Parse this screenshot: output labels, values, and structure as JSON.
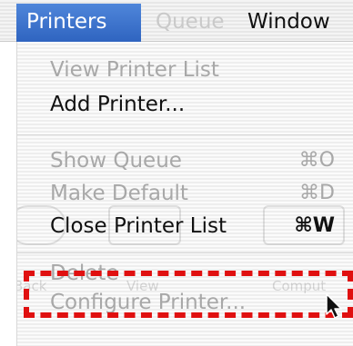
{
  "menubar": {
    "menus": [
      {
        "label": "Printers",
        "state": "open"
      },
      {
        "label": "Queue",
        "state": "disabled"
      },
      {
        "label": "Window",
        "state": "enabled"
      }
    ]
  },
  "toolbar_ghost": {
    "labels": [
      "Back",
      "View",
      "Comput"
    ]
  },
  "printers_menu": {
    "items": [
      {
        "label": "View Printer List",
        "shortcut": "",
        "enabled": false
      },
      {
        "label": "Add Printer...",
        "shortcut": "",
        "enabled": true
      },
      {
        "label": "Show Queue",
        "shortcut": "⌘O",
        "enabled": false
      },
      {
        "label": "Make Default",
        "shortcut": "⌘D",
        "enabled": false
      },
      {
        "label": "Close Printer List",
        "shortcut": "⌘W",
        "enabled": true
      },
      {
        "label": "Delete",
        "shortcut": "",
        "enabled": false
      },
      {
        "label": "Configure Printer...",
        "shortcut": "",
        "enabled": false
      }
    ]
  },
  "highlight": {
    "target": "Configure Printer...",
    "color": "#e01010"
  },
  "colors": {
    "menu_selected": "#3a6fc8",
    "text_enabled": "#111111",
    "text_disabled": "#a8a8a8"
  }
}
